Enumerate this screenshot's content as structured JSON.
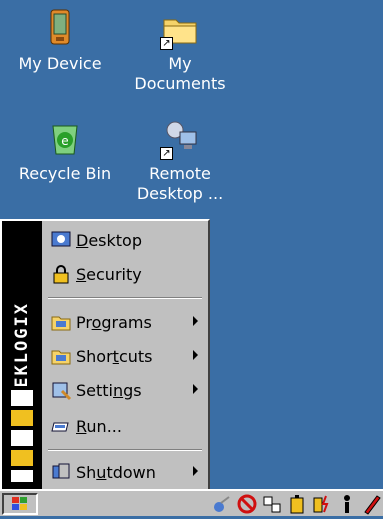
{
  "desktop": {
    "icons": [
      {
        "label": "My Device",
        "icon": "pda-icon"
      },
      {
        "label_line1": "My",
        "label_line2": "Documents",
        "icon": "folder-icon"
      },
      {
        "label": "Recycle Bin",
        "icon": "recycle-bin-icon"
      },
      {
        "label_line1": "Remote",
        "label_line2": "Desktop ...",
        "icon": "remote-desktop-icon"
      }
    ]
  },
  "start_menu": {
    "banner_text": "TEKLOGIX",
    "banner_logo": "PSION",
    "items": [
      {
        "pre": "",
        "key": "D",
        "post": "esktop",
        "icon": "desktop-icon",
        "submenu": false
      },
      {
        "pre": "",
        "key": "S",
        "post": "ecurity",
        "icon": "lock-icon",
        "submenu": false
      },
      {
        "pre": "Pr",
        "key": "o",
        "post": "grams",
        "icon": "programs-folder-icon",
        "submenu": true
      },
      {
        "pre": "Shor",
        "key": "t",
        "post": "cuts",
        "icon": "shortcuts-folder-icon",
        "submenu": true
      },
      {
        "pre": "Setti",
        "key": "n",
        "post": "gs",
        "icon": "settings-icon",
        "submenu": true
      },
      {
        "pre": "",
        "key": "R",
        "post": "un...",
        "icon": "run-icon",
        "submenu": false
      },
      {
        "pre": "Sh",
        "key": "u",
        "post": "tdown",
        "icon": "shutdown-icon",
        "submenu": true
      }
    ]
  },
  "taskbar": {
    "start_icon": "windows-flag-icon",
    "tray_icons": [
      "network-icon",
      "no-connection-icon",
      "keyboard-icon",
      "battery-icon",
      "power-icon",
      "person-icon",
      "pen-icon"
    ]
  }
}
